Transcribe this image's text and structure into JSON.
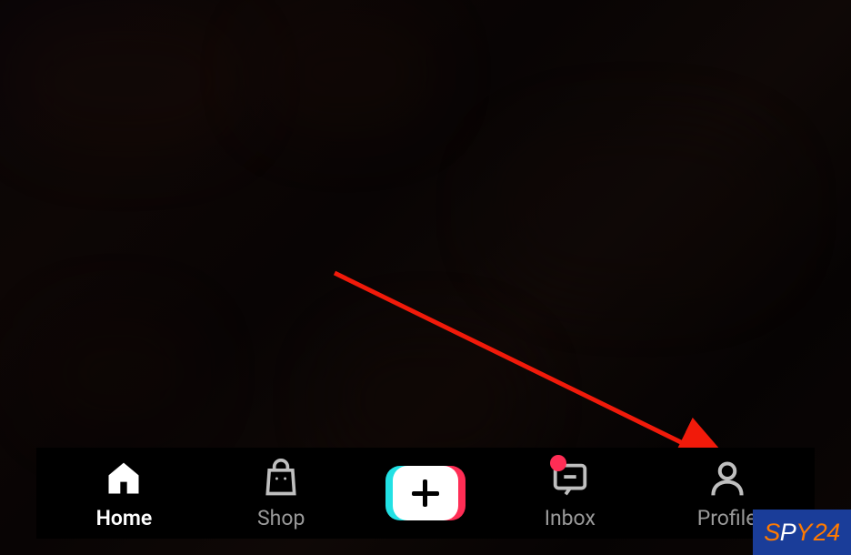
{
  "nav": {
    "home": {
      "label": "Home"
    },
    "shop": {
      "label": "Shop"
    },
    "inbox": {
      "label": "Inbox",
      "has_notification": true
    },
    "profile": {
      "label": "Profile"
    }
  },
  "watermark": {
    "s": "S",
    "p": "P",
    "y": "Y",
    "n": "24"
  },
  "colors": {
    "accent_red": "#ff2d55",
    "accent_cyan": "#22e1e4",
    "arrow": "#f11a0a",
    "watermark_bg": "#1a3d99",
    "watermark_orange": "#ff7a00"
  }
}
